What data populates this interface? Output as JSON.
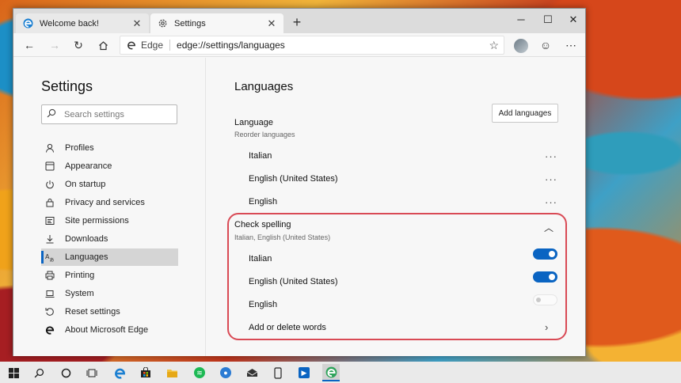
{
  "tabs": [
    {
      "title": "Welcome back!",
      "icon": "edge-icon"
    },
    {
      "title": "Settings",
      "icon": "gear-icon"
    }
  ],
  "address": {
    "site_label": "Edge",
    "url": "edge://settings/languages"
  },
  "sidebar": {
    "title": "Settings",
    "search_placeholder": "Search settings",
    "items": [
      {
        "label": "Profiles",
        "icon": "person-icon"
      },
      {
        "label": "Appearance",
        "icon": "appearance-icon"
      },
      {
        "label": "On startup",
        "icon": "power-icon"
      },
      {
        "label": "Privacy and services",
        "icon": "lock-icon"
      },
      {
        "label": "Site permissions",
        "icon": "site-permissions-icon"
      },
      {
        "label": "Downloads",
        "icon": "download-icon"
      },
      {
        "label": "Languages",
        "icon": "languages-icon",
        "active": true
      },
      {
        "label": "Printing",
        "icon": "printer-icon"
      },
      {
        "label": "System",
        "icon": "laptop-icon"
      },
      {
        "label": "Reset settings",
        "icon": "reset-icon"
      },
      {
        "label": "About Microsoft Edge",
        "icon": "edge-icon"
      }
    ]
  },
  "main": {
    "title": "Languages",
    "language_section": {
      "title": "Language",
      "subtitle": "Reorder languages",
      "add_button": "Add languages",
      "languages": [
        "Italian",
        "English (United States)",
        "English"
      ]
    },
    "spelling_section": {
      "title": "Check spelling",
      "subtitle": "Italian, English (United States)",
      "items": [
        {
          "label": "Italian",
          "enabled": true
        },
        {
          "label": "English (United States)",
          "enabled": true
        },
        {
          "label": "English",
          "enabled": false
        }
      ],
      "words_link": "Add or delete words"
    }
  },
  "colors": {
    "accent": "#0a64c2",
    "highlight": "#d94a55"
  }
}
